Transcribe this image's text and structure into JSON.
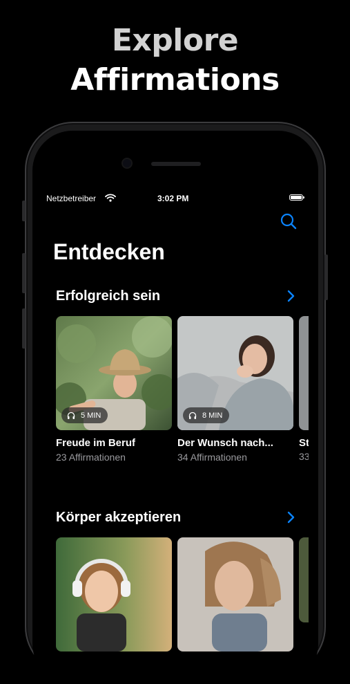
{
  "promo": {
    "headline_line1": "Explore",
    "headline_line2": "Affirmations"
  },
  "status_bar": {
    "carrier": "Netzbetreiber",
    "time": "3:02 PM"
  },
  "header": {
    "title": "Entdecken",
    "search_icon": "search-icon"
  },
  "sections": [
    {
      "title": "Erfolgreich sein",
      "cards": [
        {
          "title": "Freude im Beruf",
          "subtitle": "23 Affirmationen",
          "duration": "5 MIN"
        },
        {
          "title": "Der Wunsch nach...",
          "subtitle": "34 Affirmationen",
          "duration": "8 MIN"
        },
        {
          "title_partial": "St",
          "subtitle_partial": "33"
        }
      ]
    },
    {
      "title": "Körper akzeptieren",
      "cards": []
    }
  ],
  "colors": {
    "accent": "#0a84ff",
    "background": "#000000",
    "secondary_text": "#9a9a9e"
  }
}
